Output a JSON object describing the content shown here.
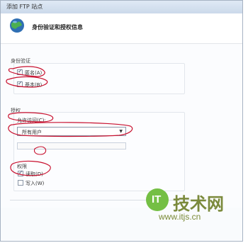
{
  "window": {
    "title": "添加 FTP 站点"
  },
  "header": {
    "title": "身份验证和授权信息",
    "icon": "globe-icon"
  },
  "auth": {
    "section_title": "身份验证",
    "options": [
      {
        "label": "匿名(A)",
        "checked": true
      },
      {
        "label": "基本(B)",
        "checked": true
      }
    ]
  },
  "authorization": {
    "section_title": "授权",
    "allow_access_label": "允许访问(C):",
    "allow_access_value": "所有用户"
  },
  "permissions": {
    "section_title": "权限",
    "options": [
      {
        "label": "读取(D)",
        "checked": true
      },
      {
        "label": "写入(W)",
        "checked": false
      }
    ]
  },
  "watermark": {
    "logo_text": "IT",
    "brand": "技术网",
    "url": "www.itjs.cn"
  },
  "colors": {
    "annotation": "#c8102e",
    "accent": "#2c5ea8"
  }
}
